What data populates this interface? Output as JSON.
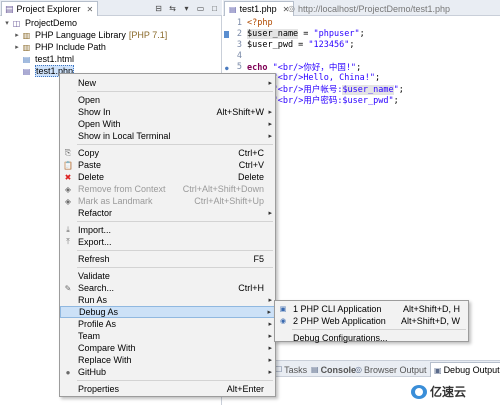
{
  "project_explorer": {
    "title": "Project Explorer",
    "close_glyph": "✕",
    "toolbar": [
      {
        "name": "collapse-all-icon",
        "glyph": "⊟"
      },
      {
        "name": "link-with-editor-icon",
        "glyph": "⇆"
      },
      {
        "name": "view-menu-icon",
        "glyph": "▾"
      },
      {
        "name": "minimize-icon",
        "glyph": "▭"
      },
      {
        "name": "maximize-icon",
        "glyph": "□"
      }
    ],
    "tree": [
      {
        "twisty": "▾",
        "icon": "project-icon",
        "glyph": "◫",
        "label": "ProjectDemo",
        "decor": "",
        "indent": 0
      },
      {
        "twisty": "▸",
        "icon": "library-icon",
        "glyph": "▥",
        "label": "PHP Language Library",
        "decor": "[PHP 7.1]",
        "indent": 1
      },
      {
        "twisty": "▸",
        "icon": "include-path-icon",
        "glyph": "▥",
        "label": "PHP Include Path",
        "decor": "",
        "indent": 1
      },
      {
        "twisty": "",
        "icon": "html-file-icon",
        "glyph": "▤",
        "label": "test1.html",
        "decor": "",
        "indent": 1
      },
      {
        "twisty": "",
        "icon": "php-file-icon",
        "glyph": "▤",
        "label": "test1.php",
        "decor": "",
        "indent": 1,
        "selected": true
      }
    ]
  },
  "editor": {
    "tabs": [
      {
        "label": "test1.php",
        "close": "✕"
      },
      {
        "label": "http://localhost/ProjectDemo/test1.php"
      }
    ],
    "lines": [
      {
        "n": "1",
        "t": "<?php"
      },
      {
        "n": "2",
        "t": "$user_name = \"phpuser\";"
      },
      {
        "n": "3",
        "t": "$user_pwd = \"123456\";"
      },
      {
        "n": "4",
        "t": ""
      },
      {
        "n": "5",
        "t": "echo \"<br/>你好，中国!\";"
      },
      {
        "n": "",
        "t": "echo \"<br/>Hello, China!\";"
      },
      {
        "n": "",
        "t": "echo \"<br/>用户帐号:$user_name\";"
      },
      {
        "n": "",
        "t": "echo \"<br/>用户密码:$user_pwd\";"
      }
    ],
    "code_parts": {
      "open_tag": "<?php",
      "var_name": "$user_name",
      "var_pwd": "$user_pwd",
      "eq": " = ",
      "semi": ";",
      "str_phpuser": "\"phpuser\"",
      "str_pwd": "\"123456\"",
      "echo_kw": "echo",
      "l5": "\"<br/>你好，中国!\"",
      "l6": "\"<br/>Hello, China!\"",
      "l7a": "\"<br/>用户帐号:",
      "l7b": "$user_name",
      "l7c": "\"",
      "l8a": "\"<br/>用户密码:$user_pwd\""
    }
  },
  "context_menu": {
    "items": [
      {
        "label": "New",
        "shortcut": "",
        "submenu": true,
        "icon": "",
        "glyph": ""
      },
      {
        "sep": true
      },
      {
        "label": "Open",
        "shortcut": "",
        "icon": "",
        "glyph": ""
      },
      {
        "label": "Show In",
        "shortcut": "Alt+Shift+W",
        "submenu": true,
        "icon": "",
        "glyph": ""
      },
      {
        "label": "Open With",
        "shortcut": "",
        "submenu": true,
        "icon": "",
        "glyph": ""
      },
      {
        "label": "Show in Local Terminal",
        "shortcut": "",
        "submenu": true,
        "icon": "",
        "glyph": ""
      },
      {
        "sep": true
      },
      {
        "label": "Copy",
        "shortcut": "Ctrl+C",
        "icon": "copy-icon",
        "glyph": "⎘"
      },
      {
        "label": "Paste",
        "shortcut": "Ctrl+V",
        "icon": "paste-icon",
        "glyph": "📋"
      },
      {
        "label": "Delete",
        "shortcut": "Delete",
        "icon": "delete-icon",
        "glyph": "✖",
        "color": "#d22"
      },
      {
        "label": "Remove from Context",
        "shortcut": "Ctrl+Alt+Shift+Down",
        "icon": "remove-context-icon",
        "glyph": "◈",
        "disabled": true
      },
      {
        "label": "Mark as Landmark",
        "shortcut": "Ctrl+Alt+Shift+Up",
        "icon": "landmark-icon",
        "glyph": "◈",
        "disabled": true
      },
      {
        "label": "Refactor",
        "shortcut": "",
        "submenu": true,
        "icon": "",
        "glyph": ""
      },
      {
        "sep": true
      },
      {
        "label": "Import...",
        "shortcut": "",
        "icon": "import-icon",
        "glyph": "⤓"
      },
      {
        "label": "Export...",
        "shortcut": "",
        "icon": "export-icon",
        "glyph": "⤒"
      },
      {
        "sep": true
      },
      {
        "label": "Refresh",
        "shortcut": "F5",
        "icon": "",
        "glyph": ""
      },
      {
        "sep": true
      },
      {
        "label": "Validate",
        "shortcut": "",
        "icon": "",
        "glyph": ""
      },
      {
        "label": "Search...",
        "shortcut": "Ctrl+H",
        "icon": "search-icon",
        "glyph": "✎"
      },
      {
        "label": "Run As",
        "shortcut": "",
        "submenu": true,
        "icon": "",
        "glyph": ""
      },
      {
        "label": "Debug As",
        "shortcut": "",
        "submenu": true,
        "icon": "",
        "glyph": "",
        "hot": true
      },
      {
        "label": "Profile As",
        "shortcut": "",
        "submenu": true,
        "icon": "",
        "glyph": ""
      },
      {
        "label": "Team",
        "shortcut": "",
        "submenu": true,
        "icon": "",
        "glyph": ""
      },
      {
        "label": "Compare With",
        "shortcut": "",
        "submenu": true,
        "icon": "",
        "glyph": ""
      },
      {
        "label": "Replace With",
        "shortcut": "",
        "submenu": true,
        "icon": "",
        "glyph": ""
      },
      {
        "label": "GitHub",
        "shortcut": "",
        "submenu": true,
        "icon": "github-icon",
        "glyph": "●"
      },
      {
        "sep": true
      },
      {
        "label": "Properties",
        "shortcut": "Alt+Enter",
        "icon": "",
        "glyph": ""
      }
    ],
    "arrow": "▸"
  },
  "debug_submenu": {
    "items": [
      {
        "label": "1 PHP CLI Application",
        "shortcut": "Alt+Shift+D, H",
        "icon": "php-cli-icon",
        "glyph": "▣"
      },
      {
        "label": "2 PHP Web Application",
        "shortcut": "Alt+Shift+D, W",
        "icon": "php-web-icon",
        "glyph": "◉"
      },
      {
        "sep": true
      },
      {
        "label": "Debug Configurations...",
        "shortcut": "",
        "icon": "",
        "glyph": ""
      }
    ]
  },
  "bottom_panel": {
    "tabs": [
      {
        "label": "Tasks",
        "icon": "tasks-icon",
        "glyph": "☐"
      },
      {
        "label": "Console",
        "icon": "console-icon",
        "glyph": "▤",
        "bold": true
      },
      {
        "label": "Browser Output",
        "icon": "browser-output-icon",
        "glyph": "◎"
      },
      {
        "label": "Debug Output",
        "icon": "debug-output-icon",
        "glyph": "▣",
        "active": true
      }
    ]
  },
  "watermark": {
    "text": "亿速云"
  }
}
